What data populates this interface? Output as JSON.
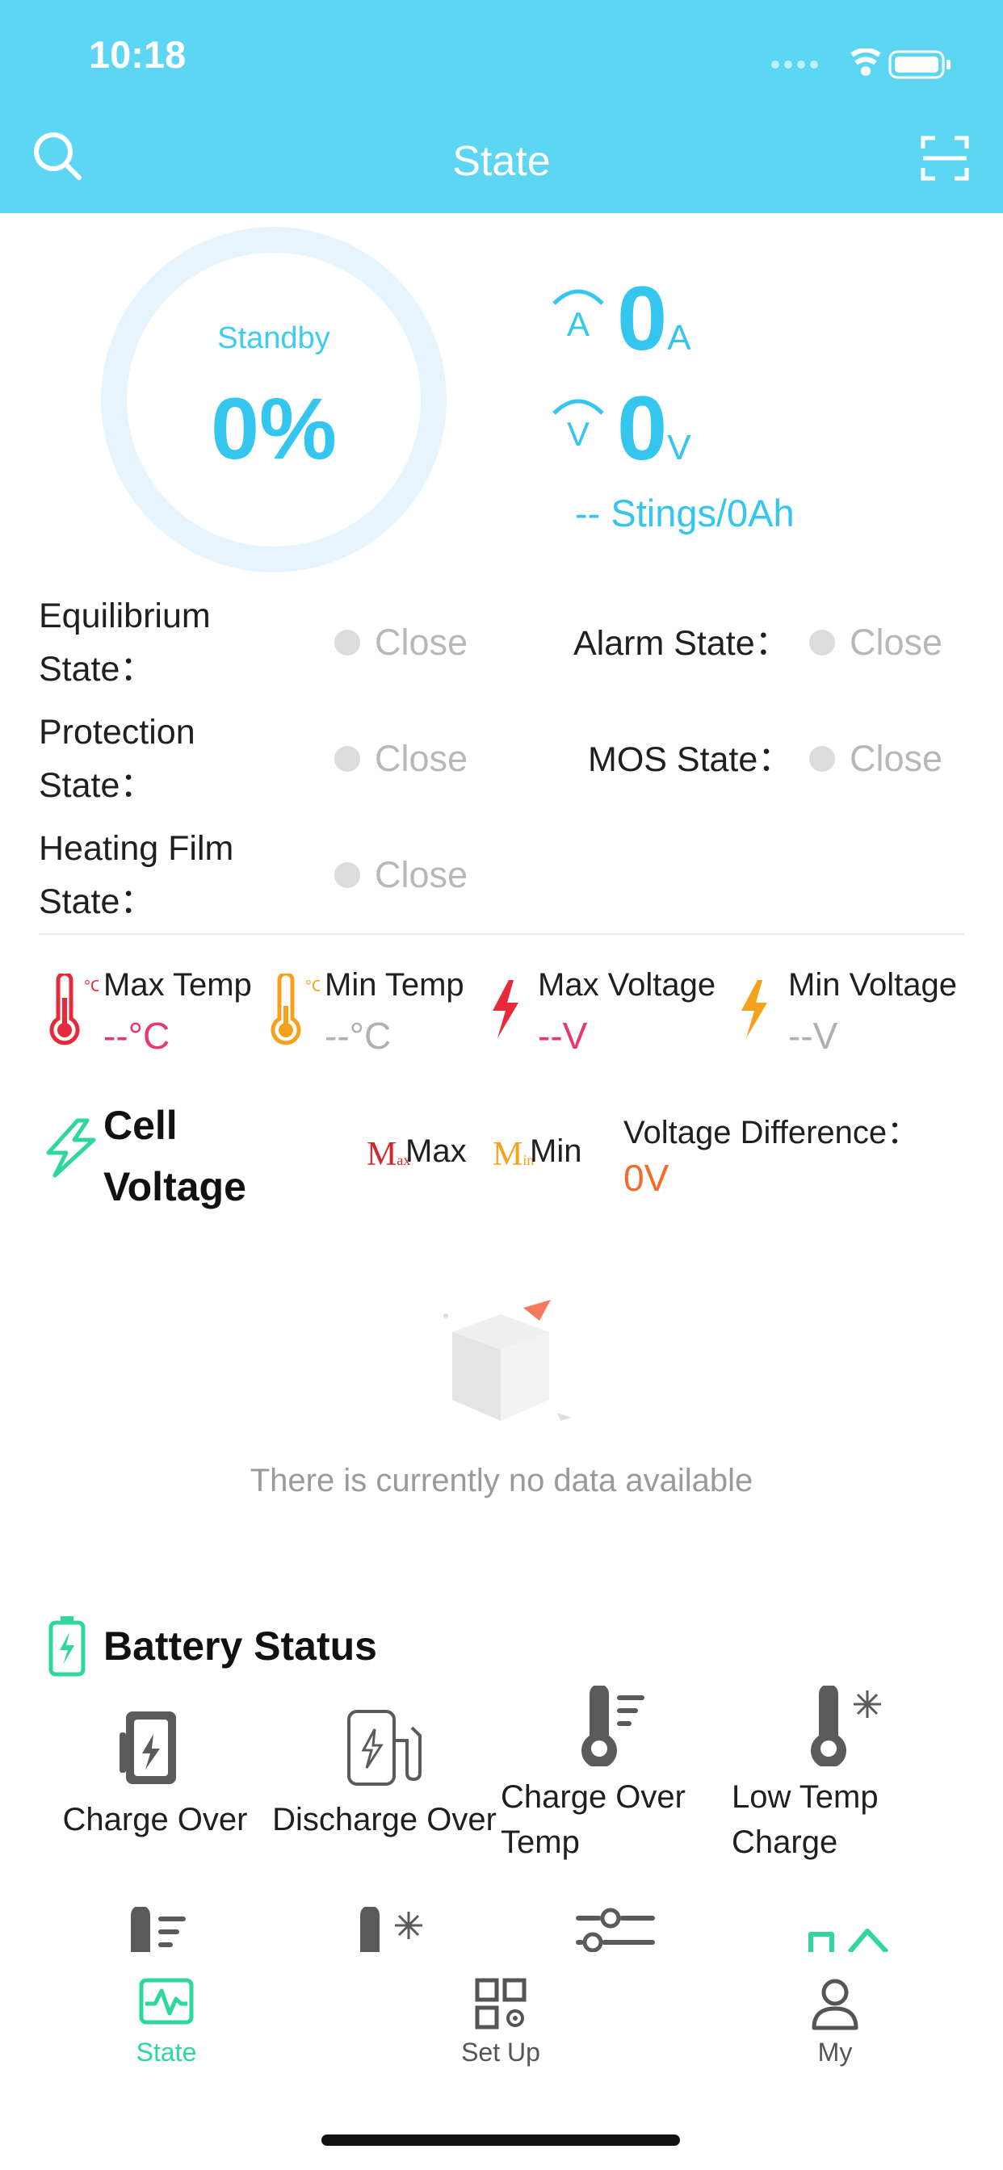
{
  "status_bar": {
    "time": "10:18"
  },
  "header": {
    "title": "State"
  },
  "gauge": {
    "status": "Standby",
    "soc": "0%",
    "fraction": 0
  },
  "current": {
    "value": "0",
    "unit": "A"
  },
  "voltage": {
    "value": "0",
    "unit": "V"
  },
  "strings": "-- Stings/0Ah",
  "states": {
    "equilibrium_label": "Equilibrium State：",
    "equilibrium_value": "Close",
    "alarm_label": "Alarm State：",
    "alarm_value": "Close",
    "protection_label": "Protection State：",
    "protection_value": "Close",
    "mos_label": "MOS State：",
    "mos_value": "Close",
    "heating_label": "Heating Film State：",
    "heating_value": "Close"
  },
  "metrics": {
    "max_temp_label": "Max Temp",
    "max_temp_value": "--°C",
    "min_temp_label": "Min Temp",
    "min_temp_value": "--°C",
    "max_voltage_label": "Max Voltage",
    "max_voltage_value": "--V",
    "min_voltage_label": "Min Voltage",
    "min_voltage_value": "--V"
  },
  "cell_voltage": {
    "title": "Cell Voltage",
    "legend_max": "Max",
    "legend_min": "Min",
    "diff_label": "Voltage Difference：",
    "diff_value": "0V",
    "empty_text": "There is currently no data available"
  },
  "battery_status": {
    "title": "Battery Status",
    "items": [
      "Charge Over",
      "Discharge Over",
      "Charge Over Temp",
      "Low Temp Charge"
    ]
  },
  "tabs": [
    {
      "label": "State",
      "active": true
    },
    {
      "label": "Set Up",
      "active": false
    },
    {
      "label": "My",
      "active": false
    }
  ],
  "colors": {
    "header": "#5dd6f4",
    "accent": "#34c6ee",
    "active_tab": "#2fd6a0",
    "max_temp": "#e8293a",
    "min_temp": "#f4a21c",
    "voltage_diff": "#f46a2c"
  },
  "icons": [
    "search-icon",
    "scan-icon",
    "current-icon",
    "voltage-icon",
    "lightning-icon",
    "battery-icon",
    "thermometer-icon",
    "pulse-icon",
    "grid-gear-icon",
    "user-icon"
  ]
}
